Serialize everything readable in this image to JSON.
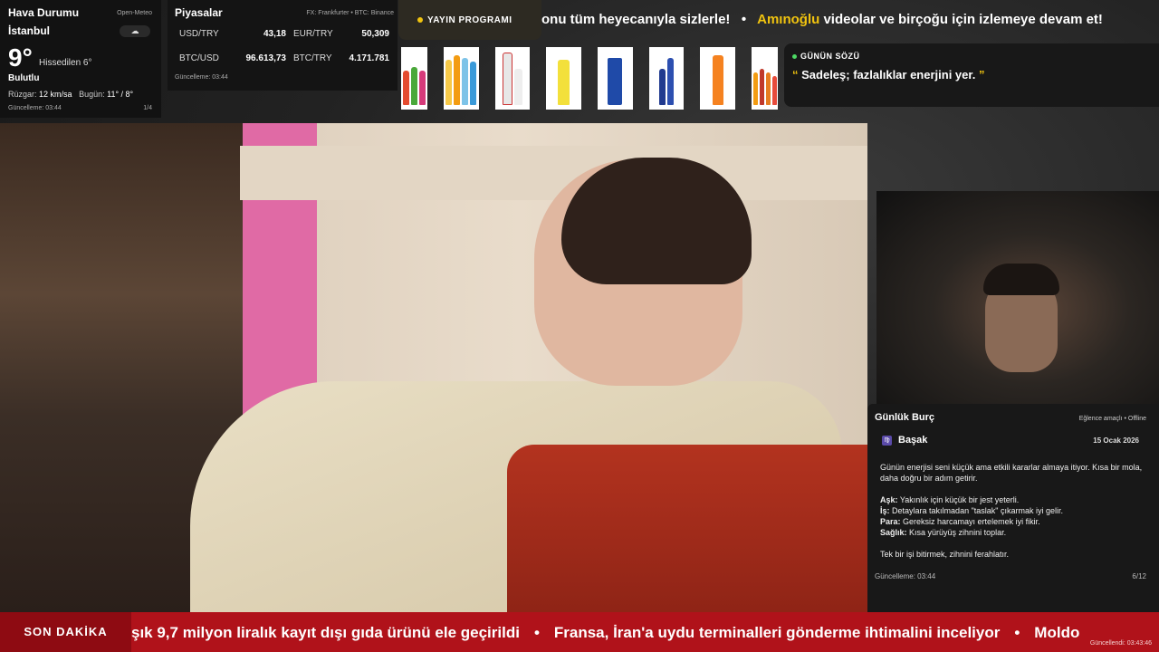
{
  "weather": {
    "title": "Hava Durumu",
    "source": "Open-Meteo",
    "city": "İstanbul",
    "temp": "9°",
    "feels": "Hissedilen 6°",
    "condition": "Bulutlu",
    "wind_label": "Rüzgar:",
    "wind_value": "12 km/sa",
    "today_label": "Bugün:",
    "today_value": "11° / 8°",
    "updated": "Güncelleme: 03:44",
    "page": "1/4",
    "cloud_icon": "cloud-icon"
  },
  "markets": {
    "title": "Piyasalar",
    "source": "FX: Frankfurter • BTC: Binance",
    "rows": [
      {
        "label": "USD/TRY",
        "value": "43,18"
      },
      {
        "label": "EUR/TRY",
        "value": "50,309"
      },
      {
        "label": "BTC/USD",
        "value": "96.613,73"
      },
      {
        "label": "BTC/TRY",
        "value": "4.171.781"
      }
    ],
    "updated": "Güncelleme: 03:44"
  },
  "schedule": {
    "label": "YAYIN PROGRAMI",
    "dot_color": "#f1c40f"
  },
  "top_crawl": {
    "part1": "onu tüm heyecanıyla sizlerle!",
    "separator": "•",
    "highlight": "Amınoğlu",
    "part2": "videolar ve birçoğu için izlemeye devam et!"
  },
  "quote": {
    "label": "GÜNÜN SÖZÜ",
    "open_mark": "“",
    "text": "Sadeleş; fazlalıklar enerjini yer.",
    "close_mark": "”"
  },
  "horoscope": {
    "title": "Günlük Burç",
    "meta": "Eğlence amaçlı • Offline",
    "sign": "Başak",
    "sign_icon": "♍",
    "date": "15 Ocak 2026",
    "intro": "Günün enerjisi seni küçük ama etkili kararlar almaya itiyor. Kısa bir mola, daha doğru bir adım getirir.",
    "lines": [
      {
        "key": "Aşk:",
        "text": "Yakınlık için küçük bir jest yeterli."
      },
      {
        "key": "İş:",
        "text": "Detaylara takılmadan \"taslak\" çıkarmak iyi gelir."
      },
      {
        "key": "Para:",
        "text": "Gereksiz harcamayı ertelemek iyi fikir."
      },
      {
        "key": "Sağlık:",
        "text": "Kısa yürüyüş zihnini toplar."
      }
    ],
    "outro": "Tek bir işi bitirmek, zihnini ferahlatır.",
    "updated": "Güncelleme: 03:44",
    "page": "6/12"
  },
  "news": {
    "tag": "SON DAKİKA",
    "items": [
      "şık 9,7 milyon liralık kayıt dışı gıda ürünü ele geçirildi",
      "Fransa, İran'a uydu terminalleri gönderme ihtimalini inceliyor",
      "Moldo"
    ],
    "separator": "•",
    "updated": "Güncellendi: 03:43:46"
  }
}
